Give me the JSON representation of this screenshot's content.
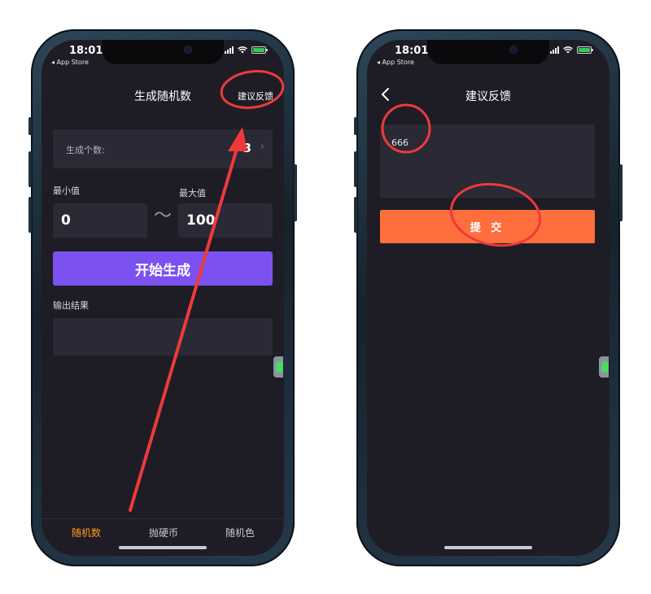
{
  "status_bar": {
    "time": "18:01",
    "back_app": "◂ App Store"
  },
  "left_screen": {
    "nav_title": "生成随机数",
    "nav_right": "建议反馈",
    "count_row": {
      "label": "生成个数:",
      "value": "3",
      "chevron": "›"
    },
    "min_label": "最小值",
    "max_label": "最大值",
    "min_value": "0",
    "max_value": "100",
    "tilde": "〜",
    "generate_button": "开始生成",
    "output_label": "输出结果",
    "output_value": "",
    "tabs": [
      {
        "label": "随机数",
        "active": true
      },
      {
        "label": "抛硬币",
        "active": false
      },
      {
        "label": "随机色",
        "active": false
      }
    ]
  },
  "right_screen": {
    "back_icon": "chevron-left-icon",
    "nav_title": "建议反馈",
    "feedback_value": "666",
    "submit_button": "提 交"
  },
  "colors": {
    "screen_bg": "#1e1d26",
    "card_bg": "#2a2936",
    "generate_purple": "#7b51ef",
    "submit_orange": "#ff6f3d",
    "active_tab": "#ff9a1f",
    "annotation_red": "#ee3a3a"
  }
}
